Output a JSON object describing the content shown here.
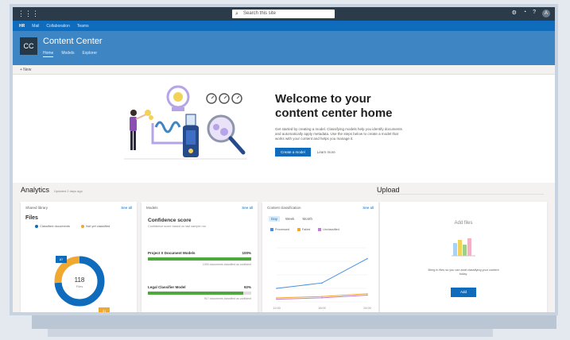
{
  "suitebar": {
    "search_placeholder": "Search this site"
  },
  "hubnav": {
    "items": [
      "HR",
      "Mail",
      "Collaboration",
      "Teams"
    ]
  },
  "site": {
    "title": "Content Center",
    "logo_text": "CC",
    "nav": [
      "Home",
      "Models",
      "Explorer"
    ]
  },
  "cmdbar": {
    "label": "+ New"
  },
  "hero": {
    "title_line1": "Welcome to your",
    "title_line2": "content center home",
    "description": "Get started by creating a model. Classifying models help you identify documents and automatically apply metadata. Use the steps below to create a model that works with your content and helps you manage it.",
    "primary_button": "Create a model",
    "link_button": "Learn more"
  },
  "analytics": {
    "title": "Analytics",
    "subtitle": "Updated 2 days ago"
  },
  "files_card": {
    "header": "Shared library",
    "see_all": "See all",
    "title": "Files",
    "legend": [
      "Classified documents",
      "Not yet classified"
    ],
    "center_value": "118",
    "center_label": "Files",
    "tag_top": "87",
    "tag_bottom": "31",
    "colors": {
      "classified": "#0f6cbd",
      "unclassified": "#f0a830"
    },
    "chart_data": {
      "type": "pie",
      "categories": [
        "Classified documents",
        "Not yet classified"
      ],
      "values": [
        87,
        31
      ]
    }
  },
  "models_card": {
    "header": "Models",
    "see_all": "See all",
    "title": "Confidence score",
    "subtitle": "Confidence score based on last sample run",
    "models": [
      {
        "name": "Project X Document Models",
        "percent_label": "100%",
        "value": 1.0,
        "foot": "1000 documents classified as confident"
      },
      {
        "name": "Legal Classifier Model",
        "percent_label": "92%",
        "value": 0.92,
        "foot": "917 documents classified as confident"
      }
    ]
  },
  "activity_card": {
    "header": "Content classification",
    "see_all": "See all",
    "tabs": [
      "Day",
      "Week",
      "Month"
    ],
    "legend": [
      "Processed",
      "Failed",
      "Unclassified"
    ],
    "colors": {
      "processed": "#4a90e2",
      "failed": "#f0a830",
      "unclassified": "#c27cd8"
    },
    "chart_data": {
      "type": "line",
      "x": [
        "12:00",
        "18:00",
        "24:00"
      ],
      "series": [
        {
          "name": "Processed",
          "values": [
            10,
            14,
            32
          ]
        },
        {
          "name": "Failed",
          "values": [
            3,
            4,
            6
          ]
        },
        {
          "name": "Unclassified",
          "values": [
            2,
            3,
            5
          ]
        }
      ],
      "ylim": [
        0,
        40
      ]
    }
  },
  "upload": {
    "title": "Upload",
    "card_title": "Add files",
    "text": "Bring in files so you can start classifying your content today.",
    "button": "Add"
  }
}
